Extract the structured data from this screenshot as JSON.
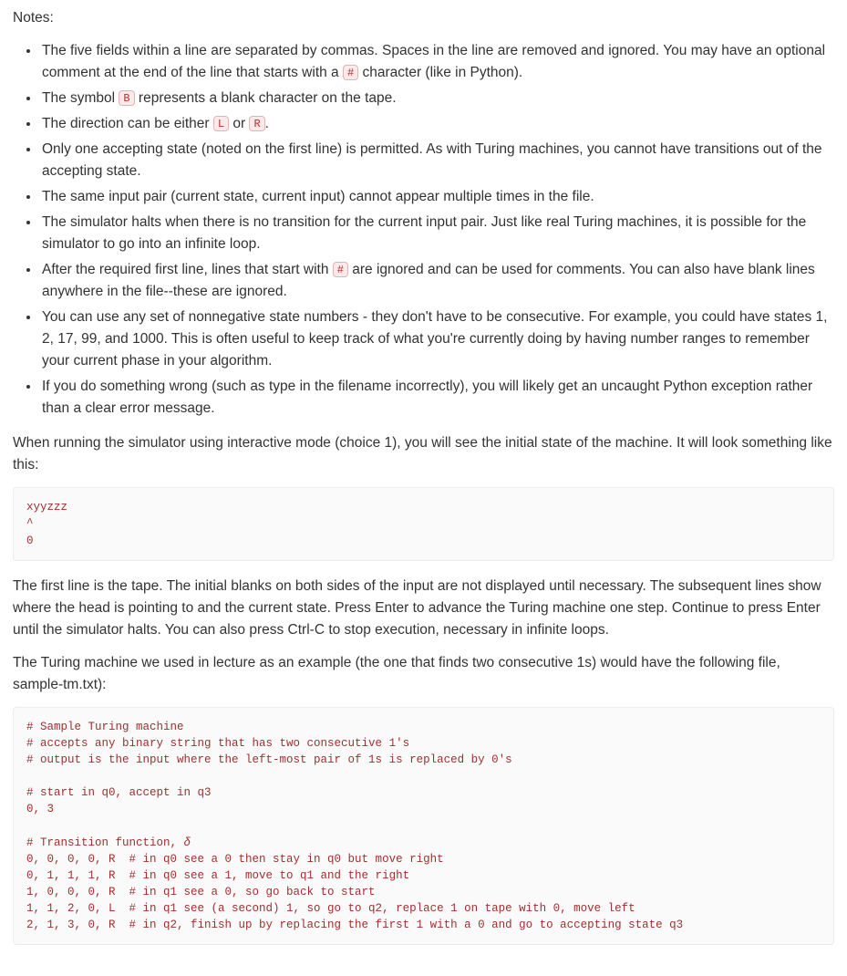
{
  "notesHeading": "Notes:",
  "bullets": {
    "b1a": "The five fields within a line are separated by commas. Spaces in the line are removed and ignored. You may have an optional comment at the end of the line that starts with a ",
    "b1b": " character (like in Python).",
    "hash": "#",
    "b2a": "The symbol ",
    "b2b": " represents a blank character on the tape.",
    "bsym": "B",
    "b3a": "The direction can be either ",
    "b3b": " or ",
    "b3c": ".",
    "lsym": "L",
    "rsym": "R",
    "b4": "Only one accepting state (noted on the first line) is permitted. As with Turing machines, you cannot have transitions out of the accepting state.",
    "b5": "The same input pair (current state, current input) cannot appear multiple times in the file.",
    "b6": "The simulator halts when there is no transition for the current input pair. Just like real Turing machines, it is possible for the simulator to go into an infinite loop.",
    "b7a": "After the required first line, lines that start with ",
    "b7b": " are ignored and can be used for comments. You can also have blank lines anywhere in the file--these are ignored.",
    "b8": "You can use any set of nonnegative state numbers - they don't have to be consecutive. For example, you could have states 1, 2, 17, 99, and 1000. This is often useful to keep track of what you're currently doing by having number ranges to remember your current phase in your algorithm.",
    "b9": "If you do something wrong (such as type in the filename incorrectly), you will likely get an uncaught Python exception rather than a clear error message."
  },
  "para1": "When running the simulator using interactive mode (choice 1), you will see the initial state of the machine. It will look something like this:",
  "codeblock1": "xyyzzz\n^\n0",
  "para2": "The first line is the tape. The initial blanks on both sides of the input are not displayed until necessary. The subsequent lines show where the head is pointing to and the current state. Press Enter to advance the Turing machine one step. Continue to press Enter until the simulator halts. You can also press Ctrl-C to stop execution, necessary in infinite loops.",
  "para3": "The Turing machine we used in lecture as an example (the one that finds two consecutive 1s) would have the following file, sample-tm.txt):",
  "codeblock2_a": "# Sample Turing machine\n# accepts any binary string that has two consecutive 1's\n# output is the input where the left-most pair of 1s is replaced by 0's\n\n# start in q0, accept in q3\n0, 3\n\n# Transition function, ",
  "delta": "δ",
  "codeblock2_b": "\n0, 0, 0, 0, R  # in q0 see a 0 then stay in q0 but move right\n0, 1, 1, 1, R  # in q0 see a 1, move to q1 and the right\n1, 0, 0, 0, R  # in q1 see a 0, so go back to start\n1, 1, 2, 0, L  # in q1 see (a second) 1, so go to q2, replace 1 on tape with 0, move left\n2, 1, 3, 0, R  # in q2, finish up by replacing the first 1 with a 0 and go to accepting state q3"
}
